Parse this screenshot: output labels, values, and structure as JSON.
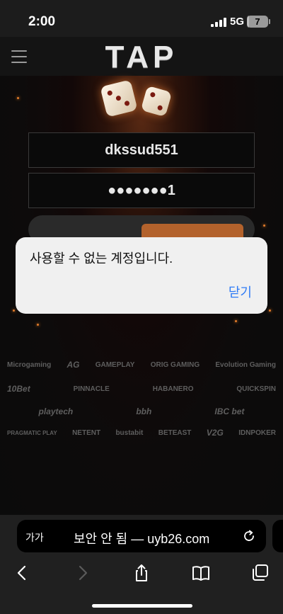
{
  "status_bar": {
    "time": "2:00",
    "network": "5G",
    "battery": "7",
    "battery_level_percent": 7
  },
  "header": {
    "logo": "TAP",
    "menu_icon": "hamburger-menu-icon"
  },
  "login": {
    "username": "dkssud551",
    "password_masked": "●●●●●●●1"
  },
  "providers": [
    [
      "Microgaming",
      "AG",
      "GAMEPLAY",
      "ORIG GAMING",
      "",
      "Evolution Gaming",
      ""
    ],
    [
      "10Bet",
      "PINNACLE",
      "HABANERO",
      "",
      "",
      "QUICKSPIN"
    ],
    [
      "",
      "",
      "playtech",
      "bbh",
      "IBC bet",
      ""
    ],
    [
      "PRAGMATIC PLAY",
      "NETENT",
      "bustabit",
      "BETEAST",
      "V2G",
      "IDNPOKER"
    ]
  ],
  "dialog": {
    "message": "사용할 수 없는 계정입니다.",
    "close_label": "닫기"
  },
  "browser": {
    "text_size_label": "가가",
    "url_text": "보안 안 됨 — uyb26.com",
    "icons": {
      "reload": "reload-icon",
      "back": "back-icon",
      "forward": "forward-icon",
      "share": "share-icon",
      "bookmarks": "bookmarks-icon",
      "tabs": "tabs-icon"
    }
  },
  "colors": {
    "accent_orange": "#b3622c",
    "dialog_link": "#2f7bf5"
  }
}
